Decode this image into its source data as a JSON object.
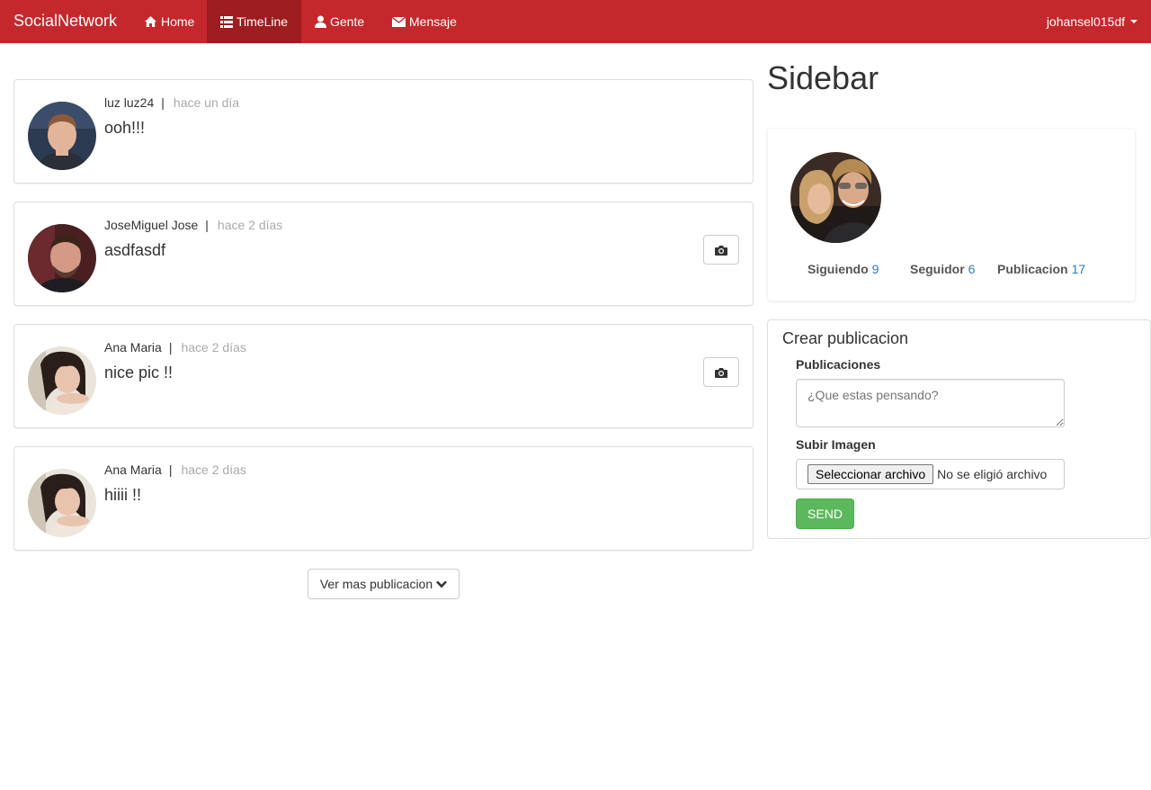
{
  "navbar": {
    "brand": "SocialNetwork",
    "items": [
      {
        "label": "Home",
        "icon": "home-icon",
        "active": false
      },
      {
        "label": "TimeLine",
        "icon": "list-icon",
        "active": true
      },
      {
        "label": "Gente",
        "icon": "user-icon",
        "active": false
      },
      {
        "label": "Mensaje",
        "icon": "envelope-icon",
        "active": false
      }
    ],
    "user": "johansel015df",
    "color": "#c4282c",
    "active_color": "#9e1d20"
  },
  "posts": [
    {
      "author": "luz luz24",
      "separator": "|",
      "time": "hace un día",
      "text": "ooh!!!",
      "has_image": false
    },
    {
      "author": "JoseMiguel Jose",
      "separator": "|",
      "time": "hace 2 días",
      "text": "asdfasdf",
      "has_image": true
    },
    {
      "author": "Ana Maria",
      "separator": "|",
      "time": "hace 2 días",
      "text": "nice pic !!",
      "has_image": true
    },
    {
      "author": "Ana Maria",
      "separator": "|",
      "time": "hace 2 días",
      "text": "hiiii !!",
      "has_image": false
    }
  ],
  "more_button": {
    "label": "Ver mas publicacion",
    "icon": "chevron-down-icon"
  },
  "sidebar": {
    "title": "Sidebar",
    "stats": [
      {
        "label": "Siguiendo",
        "value": "9"
      },
      {
        "label": "Seguidor",
        "value": "6"
      },
      {
        "label": "Publicacion",
        "value": "17"
      }
    ]
  },
  "create_post": {
    "title": "Crear publicacion",
    "text_label": "Publicaciones",
    "text_placeholder": "¿Que estas pensando?",
    "image_label": "Subir Imagen",
    "file_button": "Seleccionar archivo",
    "file_status": "No se eligió archivo",
    "send_label": "SEND",
    "send_color": "#5cb85c"
  }
}
